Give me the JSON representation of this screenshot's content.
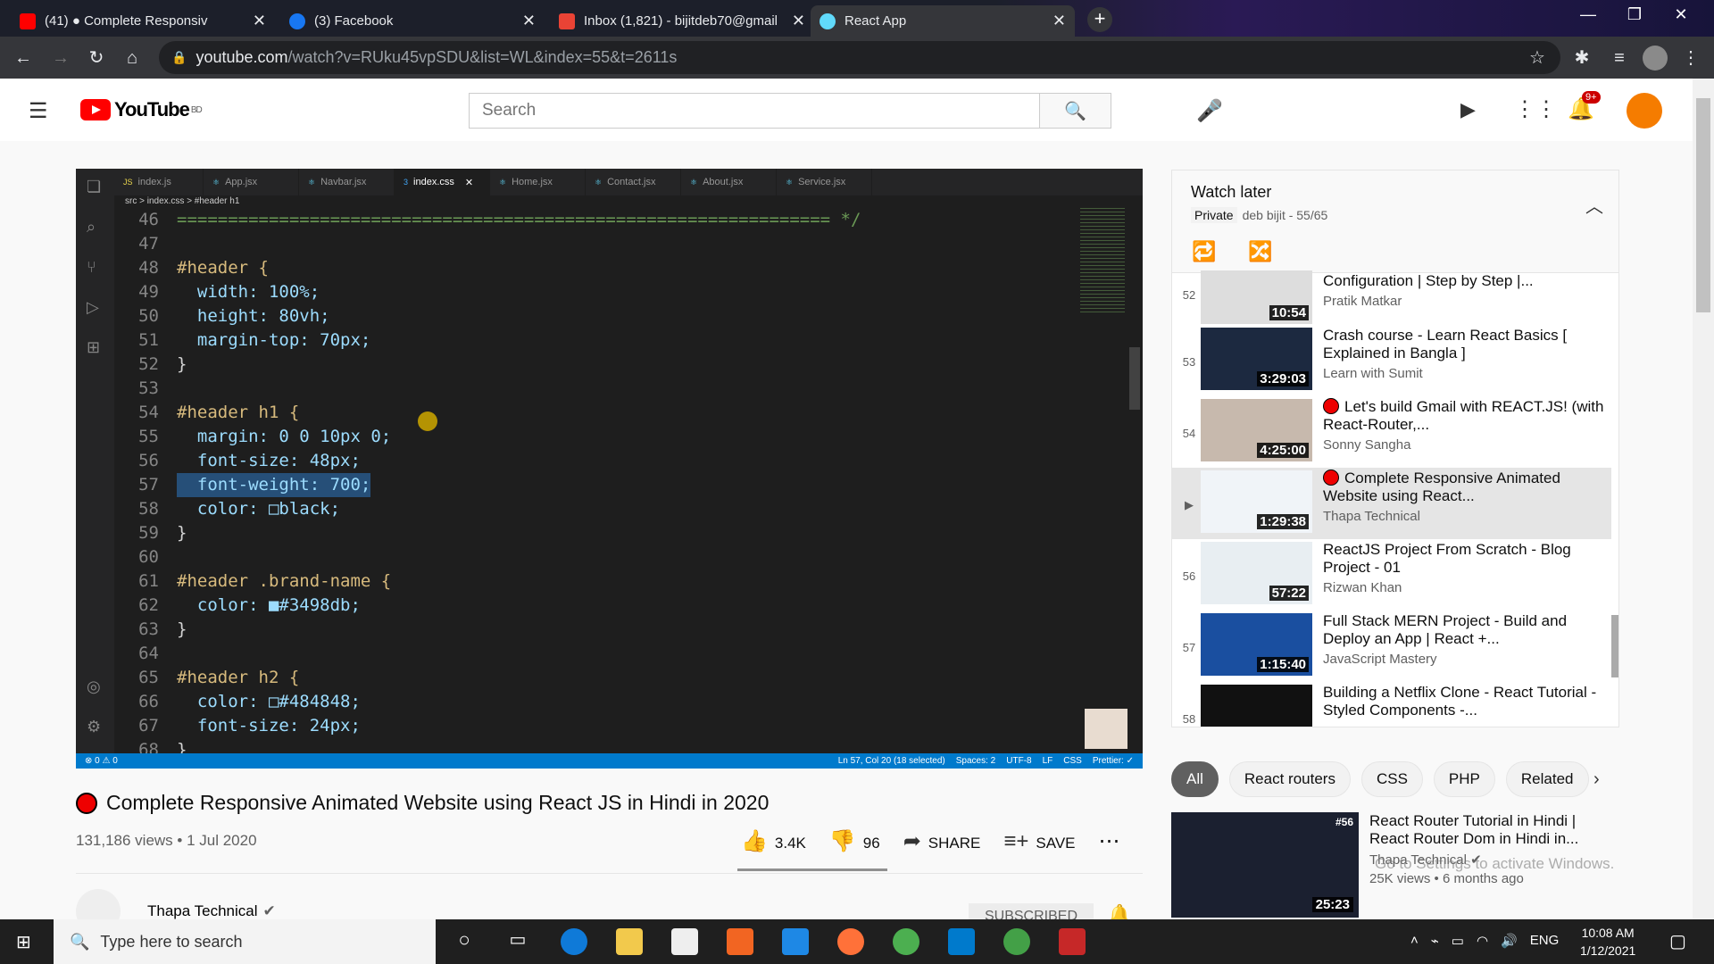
{
  "browser": {
    "tabs": [
      {
        "title": "(41) ● Complete Responsiv",
        "color": "#ff0000"
      },
      {
        "title": "(3) Facebook",
        "color": "#1877f2"
      },
      {
        "title": "Inbox (1,821) - bijitdeb70@gmail",
        "color": "#ea4335"
      },
      {
        "title": "React App",
        "color": "#61dafb"
      }
    ],
    "url_host": "youtube.com",
    "url_path": "/watch?v=RUku45vpSDU&list=WL&index=55&t=2611s"
  },
  "youtube": {
    "logo": "YouTube",
    "region": "BD",
    "search_placeholder": "Search",
    "notifications": "9+"
  },
  "vscode": {
    "tabs": [
      "index.js",
      "App.jsx",
      "Navbar.jsx",
      "index.css",
      "Home.jsx",
      "Contact.jsx",
      "About.jsx",
      "Service.jsx"
    ],
    "active_tab": "index.css",
    "breadcrumb": "src > index.css > #header h1",
    "lines": [
      {
        "n": "46",
        "text": "================================================================ */"
      },
      {
        "n": "47",
        "text": ""
      },
      {
        "n": "48",
        "text": "#header {"
      },
      {
        "n": "49",
        "text": "  width: 100%;"
      },
      {
        "n": "50",
        "text": "  height: 80vh;"
      },
      {
        "n": "51",
        "text": "  margin-top: 70px;"
      },
      {
        "n": "52",
        "text": "}"
      },
      {
        "n": "53",
        "text": ""
      },
      {
        "n": "54",
        "text": "#header h1 {"
      },
      {
        "n": "55",
        "text": "  margin: 0 0 10px 0;"
      },
      {
        "n": "56",
        "text": "  font-size: 48px;"
      },
      {
        "n": "57",
        "text": "  font-weight: 700;"
      },
      {
        "n": "58",
        "text": "  color: □black;"
      },
      {
        "n": "59",
        "text": "}"
      },
      {
        "n": "60",
        "text": ""
      },
      {
        "n": "61",
        "text": "#header .brand-name {"
      },
      {
        "n": "62",
        "text": "  color: ■#3498db;"
      },
      {
        "n": "63",
        "text": "}"
      },
      {
        "n": "64",
        "text": ""
      },
      {
        "n": "65",
        "text": "#header h2 {"
      },
      {
        "n": "66",
        "text": "  color: □#484848;"
      },
      {
        "n": "67",
        "text": "  font-size: 24px;"
      },
      {
        "n": "68",
        "text": "}"
      }
    ],
    "status_left": "⊗ 0 ⚠ 0",
    "status_right": [
      "Ln 57, Col 20 (18 selected)",
      "Spaces: 2",
      "UTF-8",
      "LF",
      "CSS",
      "Prettier: ✓"
    ]
  },
  "video": {
    "title": "Complete Responsive Animated Website using React JS in Hindi in 2020",
    "views": "131,186 views • 1 Jul 2020",
    "likes": "3.4K",
    "dislikes": "96",
    "share": "SHARE",
    "save": "SAVE",
    "like_ratio": 0.97,
    "channel": "Thapa Technical",
    "subscribed": "SUBSCRIBED"
  },
  "watch_later": {
    "title": "Watch later",
    "privacy": "Private",
    "owner": "deb bijit - 55/65",
    "items": [
      {
        "num": "52",
        "title": "Configuration | Step by Step |...",
        "author": "Pratik Matkar",
        "duration": "10:54",
        "live": false
      },
      {
        "num": "53",
        "title": "Crash course - Learn React Basics [ Explained in Bangla ]",
        "author": "Learn with Sumit",
        "duration": "3:29:03",
        "live": false
      },
      {
        "num": "54",
        "title": "Let's build Gmail with REACT.JS! (with React-Router,...",
        "author": "Sonny Sangha",
        "duration": "4:25:00",
        "live": true
      },
      {
        "num": "▶",
        "title": "Complete Responsive Animated Website using React...",
        "author": "Thapa Technical",
        "duration": "1:29:38",
        "live": true
      },
      {
        "num": "56",
        "title": "ReactJS Project From Scratch - Blog Project - 01",
        "author": "Rizwan Khan",
        "duration": "57:22",
        "live": false
      },
      {
        "num": "57",
        "title": "Full Stack MERN Project - Build and Deploy an App | React +...",
        "author": "JavaScript Mastery",
        "duration": "1:15:40",
        "live": false
      },
      {
        "num": "58",
        "title": "Building a Netflix Clone - React Tutorial - Styled Components -...",
        "author": "",
        "duration": "",
        "live": false
      }
    ]
  },
  "chips": [
    "All",
    "React routers",
    "CSS",
    "PHP",
    "Related"
  ],
  "recommended": {
    "title": "React Router Tutorial in Hindi | React Router Dom in Hindi in...",
    "channel": "Thapa Technical",
    "meta": "25K views • 6 months ago",
    "duration": "25:23",
    "badge": "#56"
  },
  "activate_windows": "Go to Settings to activate Windows.",
  "taskbar": {
    "search_placeholder": "Type here to search",
    "time": "10:08 AM",
    "date": "1/12/2021",
    "lang": "ENG"
  }
}
